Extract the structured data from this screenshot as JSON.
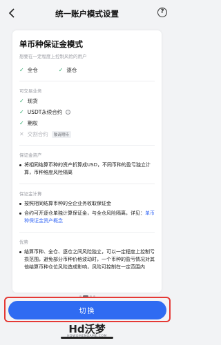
{
  "header": {
    "back_icon": "chevron-left-icon",
    "title": "统一账户模式设置",
    "help_icon": "question-circle-icon"
  },
  "mode": {
    "title": "单币种保证金模式",
    "subtitle": "想要在一定程度上控制风险的用户",
    "margin_types": [
      {
        "label": "全仓",
        "enabled": true
      },
      {
        "label": "逐仓",
        "enabled": true
      }
    ]
  },
  "tradable": {
    "label": "可交易业务",
    "items": [
      {
        "label": "现货",
        "enabled": true
      },
      {
        "label": "USDT永续合约",
        "enabled": true
      },
      {
        "label": "期权",
        "enabled": true
      },
      {
        "label": "交割合约",
        "enabled": false,
        "badge": "敬请期待"
      }
    ]
  },
  "margin_assets": {
    "label": "保证金资产",
    "bullets": [
      "将相同结算币种的资产折算成USD，不同币种的盈亏独立计算，币种维度风险隔离"
    ]
  },
  "margin_calc": {
    "label": "保证金计算",
    "bullet1": "按照相同结算币种的全企业务收取保证金",
    "bullet2_text": "合约可开逐仓单独计算保证金，与全仓风险隔离，详见：",
    "bullet2_link": "单币种保证金资产概念"
  },
  "advantage": {
    "label": "优势",
    "bullets": [
      "结算币种、全仓、逐仓之间风险独立，可以一定程度上控制亏损范围，避免部分币种价格波动时，一个币种的盈亏情况对其他结算币种仓位风险造成影响，风险可控制在一定范围内"
    ]
  },
  "pager": {
    "count": 4,
    "active": 1
  },
  "action": {
    "switch_label": "切换"
  },
  "watermark": {
    "main": "Hd沃梦",
    "sub": "HDWOMENGAME.COM"
  },
  "colors": {
    "accent": "#2f6bf2",
    "check": "#2da96b",
    "highlight_border": "#e53935",
    "link": "#3b6cf6"
  }
}
